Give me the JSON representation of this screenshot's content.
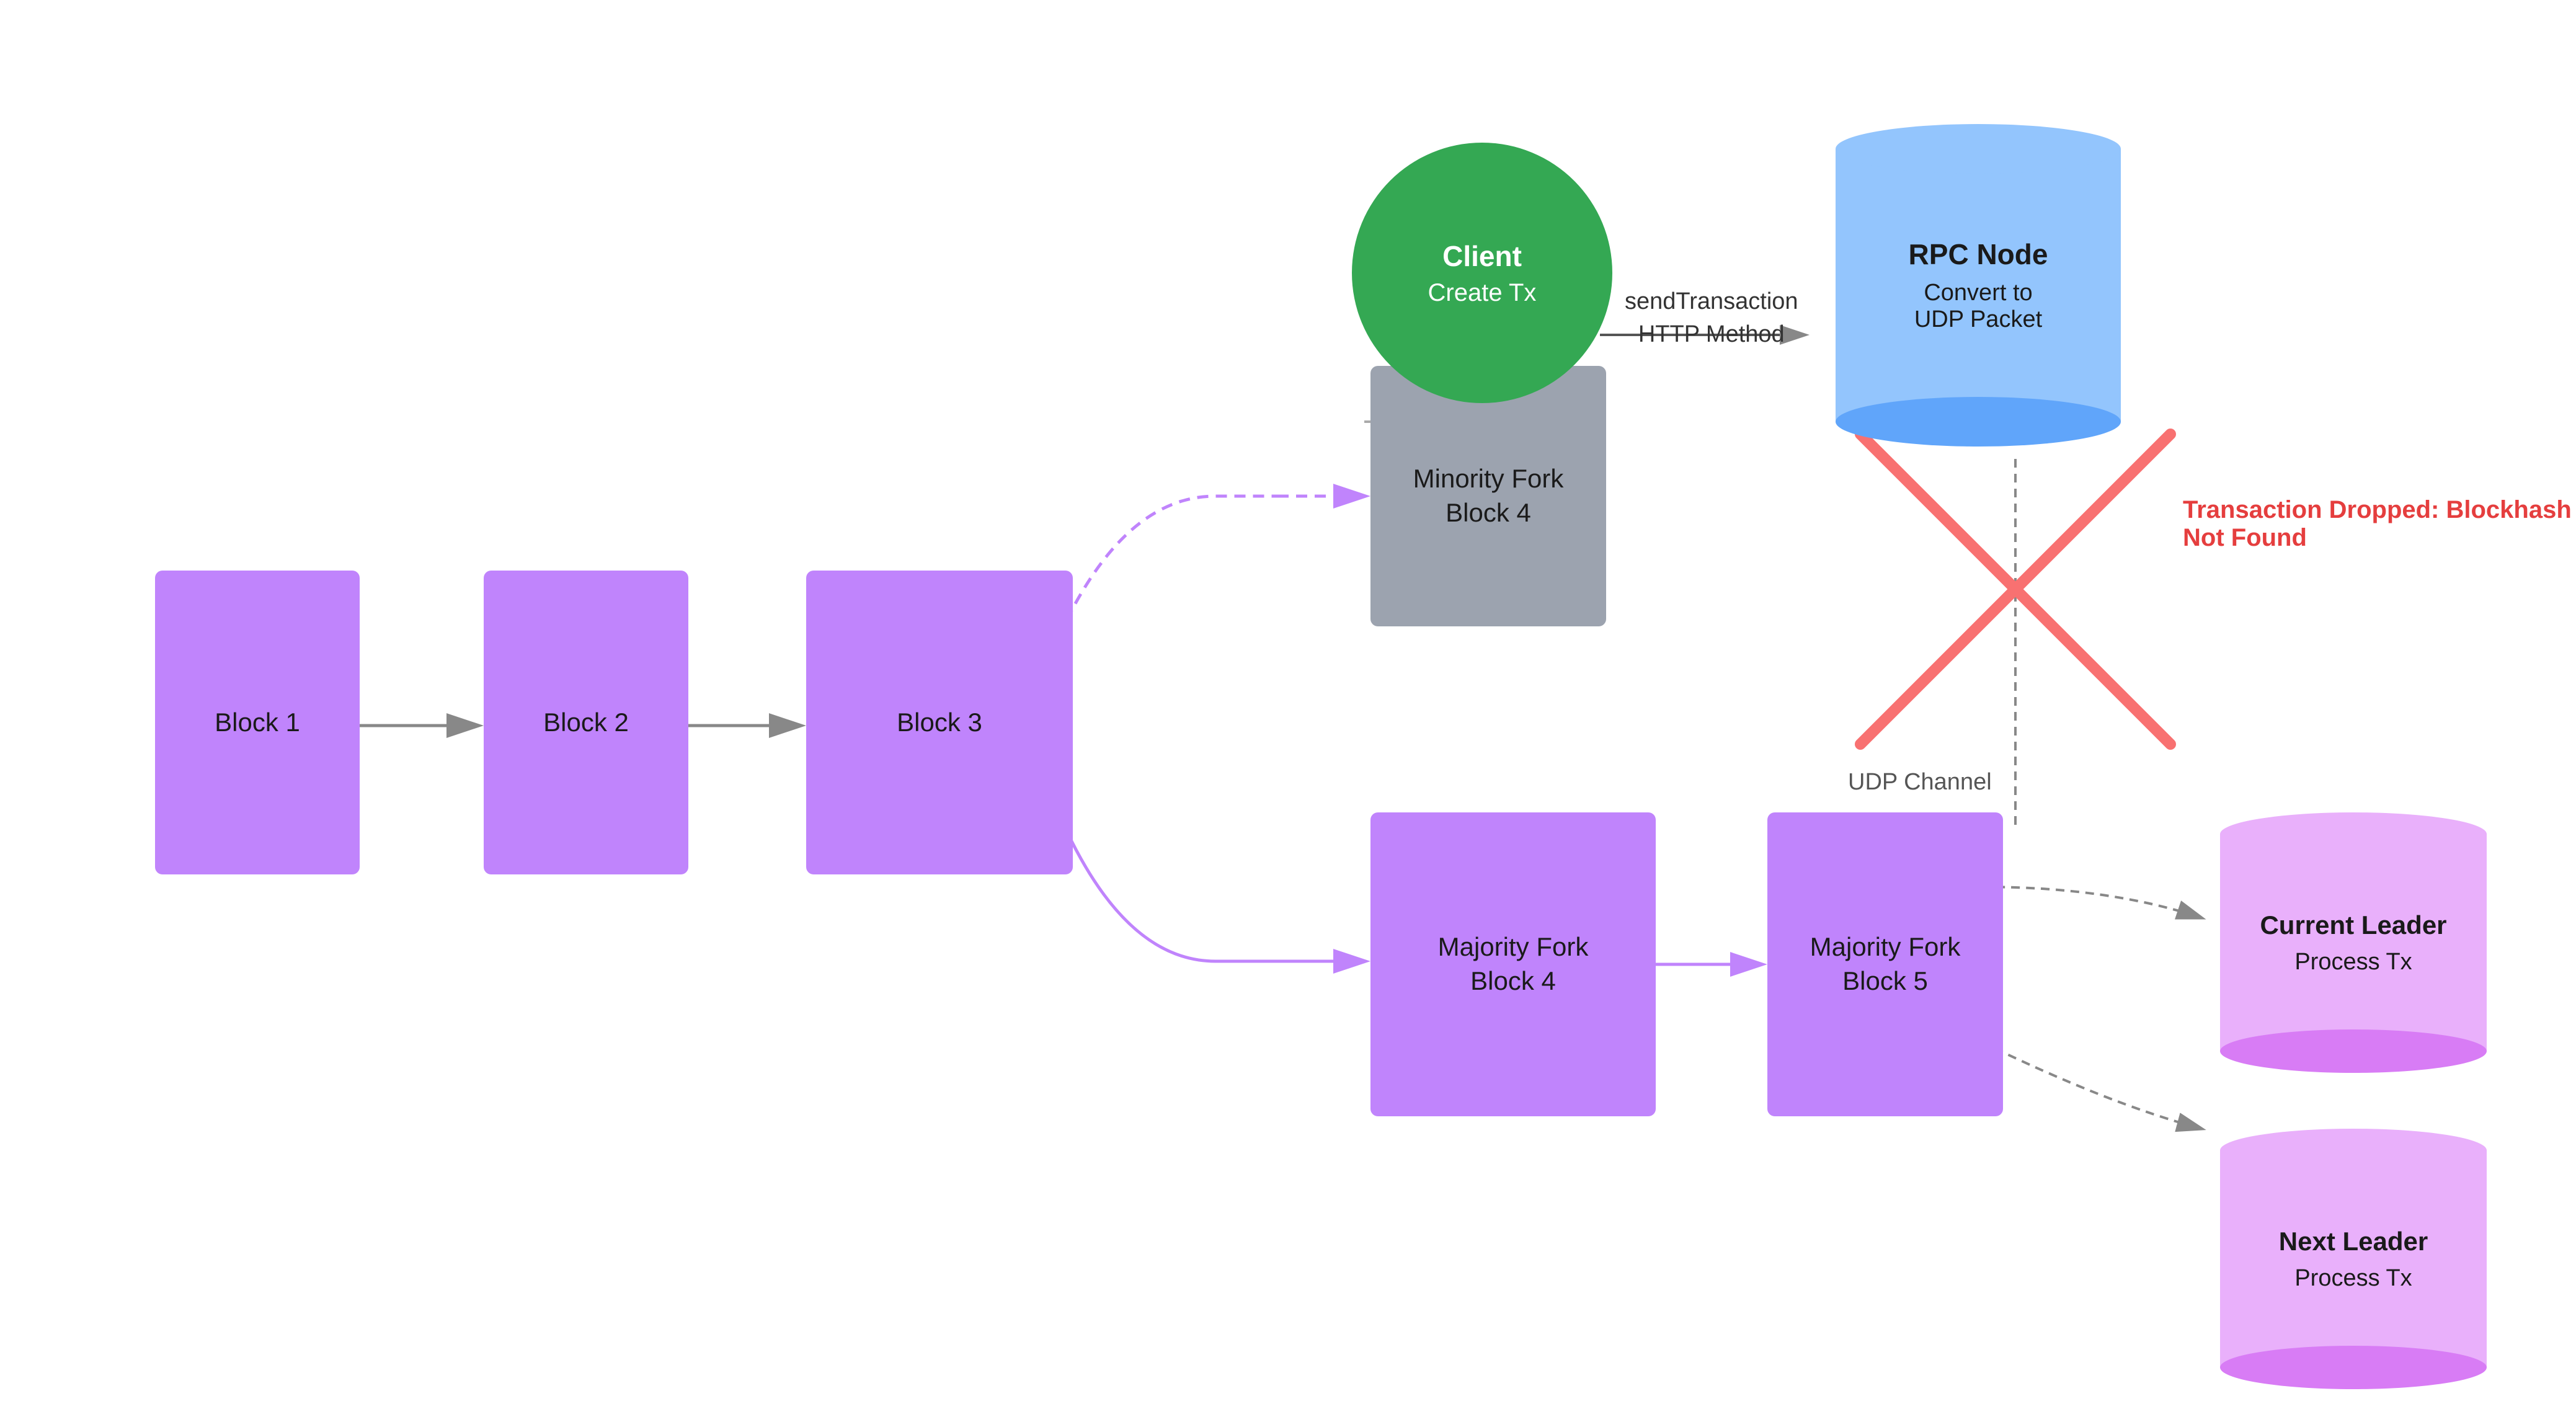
{
  "blocks": {
    "block1": {
      "label": "Block 1"
    },
    "block2": {
      "label": "Block 2"
    },
    "block3": {
      "label": "Block 3"
    },
    "minority_fork_block4": {
      "label": "Minority Fork\nBlock 4"
    },
    "majority_fork_block4": {
      "label": "Majority Fork\nBlock 4"
    },
    "majority_fork_block5": {
      "label": "Majority Fork\nBlock 5"
    }
  },
  "client": {
    "title": "Client",
    "subtitle": "Create Tx"
  },
  "rpc_node": {
    "title": "RPC Node",
    "subtitle": "Convert to\nUDP Packet"
  },
  "leaders": {
    "current": {
      "title": "Current Leader",
      "subtitle": "Process Tx"
    },
    "next": {
      "title": "Next Leader",
      "subtitle": "Process Tx"
    }
  },
  "labels": {
    "send_tx": "sendTransaction\nHTTP Method",
    "udp_channel": "UDP Channel",
    "tx_dropped": "Transaction Dropped: Blockhash Not Found"
  },
  "colors": {
    "purple": "#c084fc",
    "gray": "#9ca3af",
    "blue": "#93c5fd",
    "green": "#34a853",
    "red": "#e53e3e",
    "leader_purple": "#e9b0fb",
    "leader_purple_dark": "#d87cf5"
  }
}
